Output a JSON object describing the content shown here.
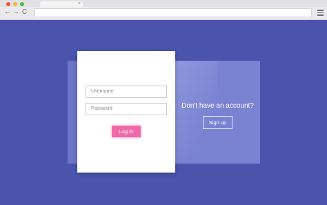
{
  "browser": {
    "tab_close": "×",
    "back_glyph": "←",
    "forward_glyph": "→",
    "reload_glyph": "C",
    "window_dots": [
      "red",
      "yellow",
      "green"
    ],
    "icons": [
      "back-arrow-icon",
      "forward-arrow-icon",
      "reload-icon",
      "menu-icon",
      "close-icon"
    ]
  },
  "login": {
    "username_placeholder": "Username",
    "password_placeholder": "Password",
    "login_label": "Log in"
  },
  "signup": {
    "prompt": "Don't have an account?",
    "button_label": "Sign up"
  },
  "colors": {
    "background": "#4a54ad",
    "accent_button": "#f06aa9",
    "panel": "#6b74c9"
  }
}
